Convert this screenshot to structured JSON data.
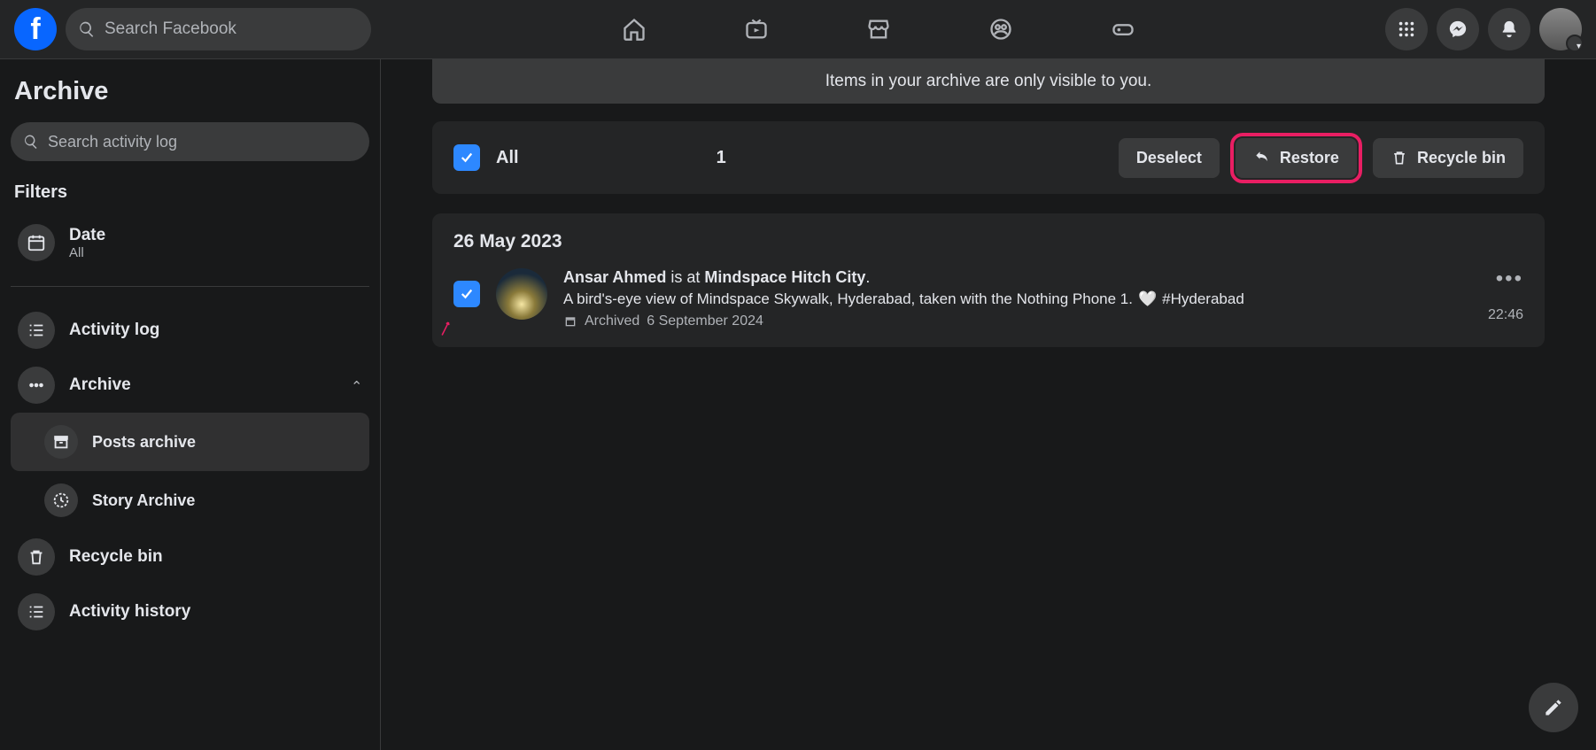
{
  "header": {
    "search_placeholder": "Search Facebook"
  },
  "sidebar": {
    "title": "Archive",
    "search_placeholder": "Search activity log",
    "filters_heading": "Filters",
    "date_filter": {
      "label": "Date",
      "value": "All"
    },
    "nav": {
      "activity_log": "Activity log",
      "archive": "Archive",
      "posts_archive": "Posts archive",
      "story_archive": "Story Archive",
      "recycle_bin": "Recycle bin",
      "activity_history": "Activity history"
    }
  },
  "main": {
    "banner": "Items in your archive are only visible to you.",
    "toolbar": {
      "all_label": "All",
      "selected_count": "1",
      "deselect": "Deselect",
      "restore": "Restore",
      "recycle_bin": "Recycle bin"
    },
    "group_date": "26 May 2023",
    "post": {
      "author": "Ansar Ahmed",
      "verb": " is at ",
      "place": "Mindspace Hitch City",
      "period": ".",
      "description": "A bird's-eye view of Mindspace Skywalk, Hyderabad, taken with the Nothing Phone 1. ",
      "hashtag": "#Hyderabad",
      "archived_prefix": "Archived ",
      "archived_date": "6 September 2024",
      "time": "22:46"
    }
  }
}
